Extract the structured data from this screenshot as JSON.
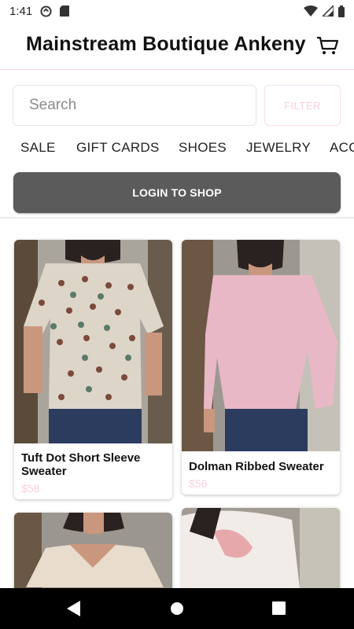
{
  "status": {
    "time": "1:41"
  },
  "header": {
    "title": "Mainstream Boutique Ankeny"
  },
  "search": {
    "placeholder": "Search",
    "filter_label": "FILTER"
  },
  "categories": [
    "SALE",
    "GIFT CARDS",
    "SHOES",
    "JEWELRY",
    "ACC"
  ],
  "login": {
    "label": "LOGIN TO SHOP"
  },
  "products": [
    {
      "name": "Tuft Dot Short Sleeve Sweater",
      "price": "$58"
    },
    {
      "name": "Dolman Ribbed Sweater",
      "price": "$56"
    }
  ],
  "colors": {
    "accent_pink": "#f7d1e0",
    "login_bg": "#5b5b5b"
  }
}
